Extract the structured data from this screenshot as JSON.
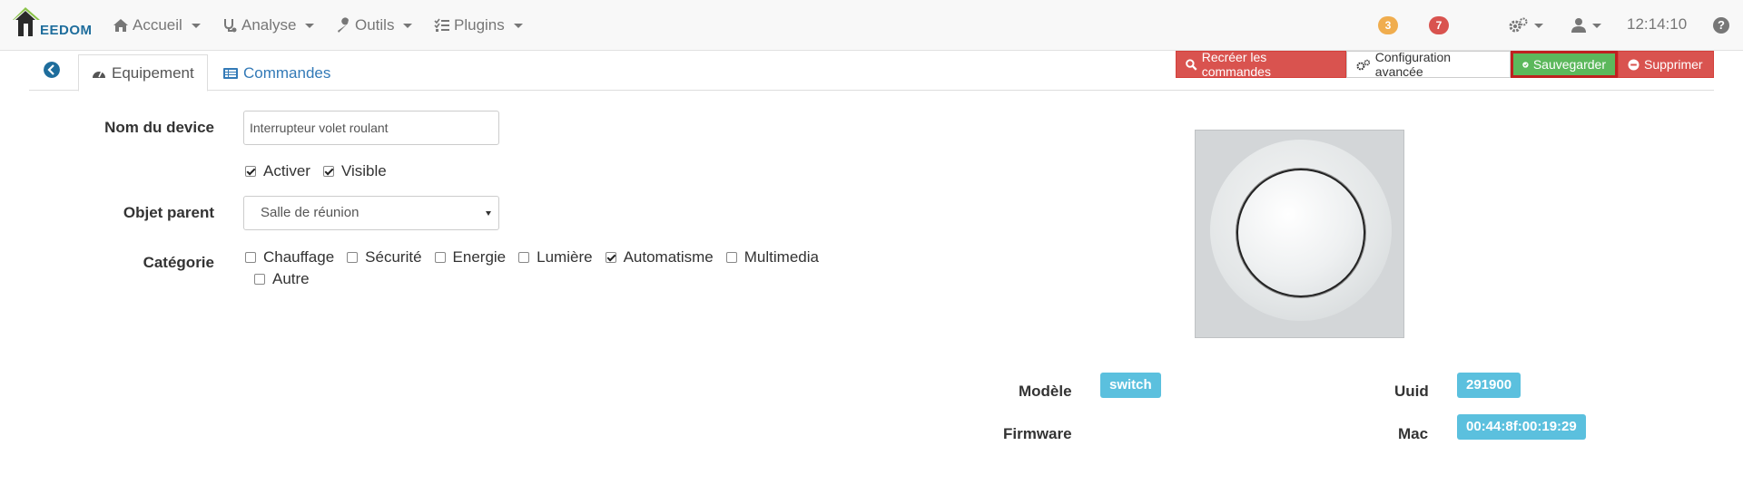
{
  "navbar": {
    "brand": "EEDOM",
    "menu": [
      {
        "label": "Accueil",
        "icon": "home-icon"
      },
      {
        "label": "Analyse",
        "icon": "stethoscope-icon"
      },
      {
        "label": "Outils",
        "icon": "wrench-icon"
      },
      {
        "label": "Plugins",
        "icon": "tasks-icon"
      }
    ],
    "badges": {
      "warning": "3",
      "danger": "7"
    },
    "time": "12:14:10",
    "help": "?"
  },
  "tabs": {
    "equipement": "Equipement",
    "commandes": "Commandes"
  },
  "actions": {
    "recreate": "Recréer les commandes",
    "config": "Configuration avancée",
    "save": "Sauvegarder",
    "delete": "Supprimer"
  },
  "form": {
    "name_label": "Nom du device",
    "name_value": "Interrupteur volet roulant",
    "activate_label": "Activer",
    "visible_label": "Visible",
    "parent_label": "Objet parent",
    "parent_value": "Salle de réunion",
    "category_label": "Catégorie",
    "categories": [
      {
        "label": "Chauffage",
        "checked": false
      },
      {
        "label": "Sécurité",
        "checked": false
      },
      {
        "label": "Energie",
        "checked": false
      },
      {
        "label": "Lumière",
        "checked": false
      },
      {
        "label": "Automatisme",
        "checked": true
      },
      {
        "label": "Multimedia",
        "checked": false
      },
      {
        "label": "Autre",
        "checked": false
      }
    ]
  },
  "info": {
    "model_label": "Modèle",
    "model_value": "switch",
    "firmware_label": "Firmware",
    "uuid_label": "Uuid",
    "uuid_value": "291900",
    "mac_label": "Mac",
    "mac_value": "00:44:8f:00:19:29"
  },
  "colors": {
    "primary": "#337ab7",
    "danger": "#d9534f",
    "success": "#5cb85c",
    "info": "#5bc0de",
    "warning": "#f0ad4e"
  }
}
